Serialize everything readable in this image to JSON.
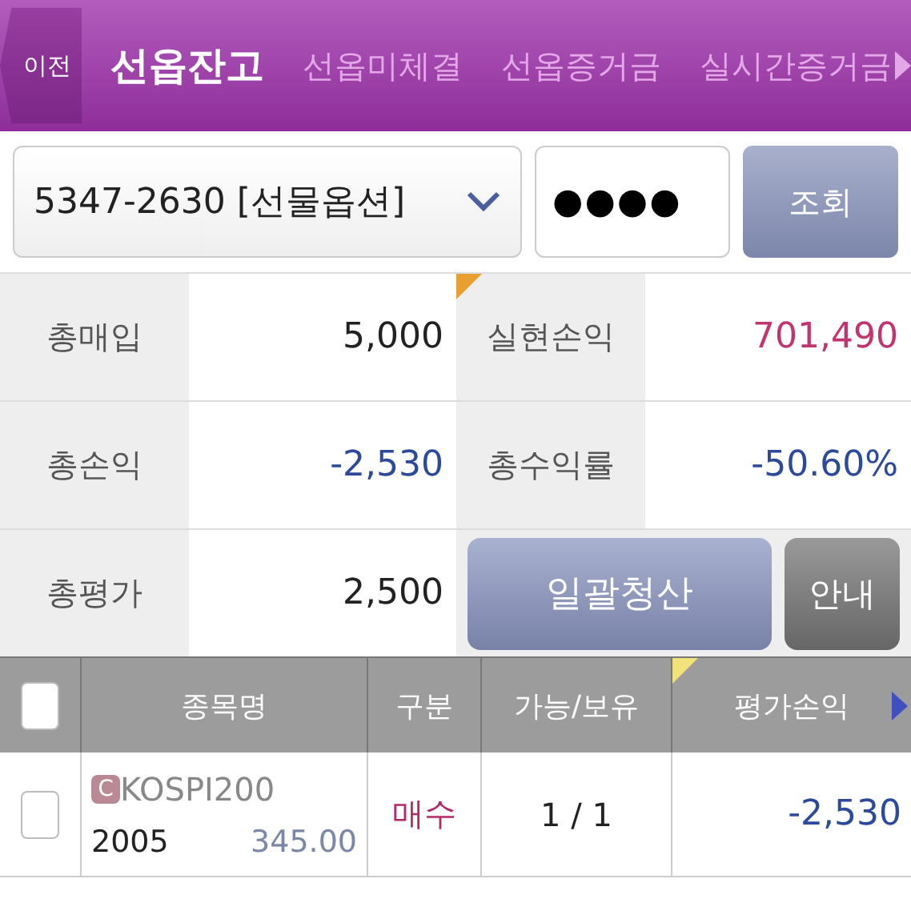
{
  "header": {
    "back_label": "이전",
    "tabs": [
      {
        "label": "선옵잔고",
        "selected": true
      },
      {
        "label": "선옵미체결",
        "selected": false
      },
      {
        "label": "선옵증거금",
        "selected": false
      },
      {
        "label": "실시간증거금",
        "selected": false
      }
    ]
  },
  "form": {
    "account": "5347-2630 [선물옵션]",
    "password": "●●●●",
    "search_button": "조회"
  },
  "summary": [
    {
      "cells": [
        {
          "label": "총매입",
          "value": "5,000",
          "color": "#222222"
        },
        {
          "label": "실현손익",
          "value": "701,490",
          "color": "#c2336f"
        }
      ]
    },
    {
      "cells": [
        {
          "label": "총손익",
          "value": "-2,530",
          "color": "#2b4a9c"
        },
        {
          "label": "총수익률",
          "value": "-50.60%",
          "color": "#2b4a9c"
        }
      ]
    },
    {
      "cells": [
        {
          "label": "총평가",
          "value": "2,500",
          "color": "#222222"
        }
      ]
    }
  ],
  "actions": {
    "settle_all": "일괄청산",
    "guide": "안내"
  },
  "table": {
    "select_all_checked": false,
    "columns": [
      "종목명",
      "구분",
      "가능/보유",
      "평가손익"
    ],
    "rows": [
      {
        "checked": false,
        "badge": "C",
        "name": "KOSPI200",
        "code": "2005",
        "price": "345.00",
        "side": "매수",
        "quantity": "1 / 1",
        "pnl": "-2,530",
        "color": "#2b4a9c"
      }
    ]
  }
}
